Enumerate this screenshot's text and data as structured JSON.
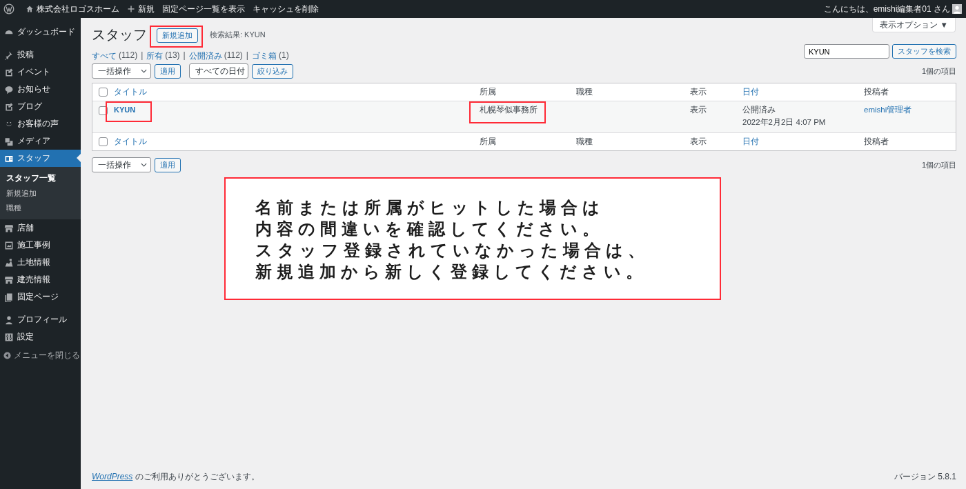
{
  "admin_bar": {
    "site_name": "株式会社ロゴスホーム",
    "new_label": "新規",
    "links": [
      "固定ページ一覧を表示",
      "キャッシュを削除"
    ],
    "greeting": "こんにちは、emishi編集者01 さん"
  },
  "sidebar": {
    "groups": [
      [
        {
          "label": "ダッシュボード",
          "kind": "gauge",
          "selected": false
        }
      ],
      [
        {
          "label": "投稿",
          "kind": "pin",
          "selected": false
        },
        {
          "label": "イベント",
          "kind": "note",
          "selected": false
        },
        {
          "label": "お知らせ",
          "kind": "bubble",
          "selected": false
        },
        {
          "label": "ブログ",
          "kind": "note",
          "selected": false
        },
        {
          "label": "お客様の声",
          "kind": "smile",
          "selected": false
        },
        {
          "label": "メディア",
          "kind": "media",
          "selected": false
        },
        {
          "label": "スタッフ",
          "kind": "card",
          "selected": true,
          "children": [
            {
              "label": "スタッフ一覧",
              "selected": true
            },
            {
              "label": "新規追加",
              "selected": false
            },
            {
              "label": "職種",
              "selected": false
            }
          ]
        },
        {
          "label": "店舗",
          "kind": "store",
          "selected": false
        },
        {
          "label": "施工事例",
          "kind": "gallery",
          "selected": false
        },
        {
          "label": "土地情報",
          "kind": "land",
          "selected": false
        },
        {
          "label": "建売情報",
          "kind": "store",
          "selected": false
        },
        {
          "label": "固定ページ",
          "kind": "pages",
          "selected": false
        }
      ],
      [
        {
          "label": "プロフィール",
          "kind": "person",
          "selected": false
        },
        {
          "label": "設定",
          "kind": "sliders",
          "selected": false
        }
      ]
    ],
    "collapse_label": "メニューを閉じる"
  },
  "screen_options": "表示オプション ▼",
  "page": {
    "title": "スタッフ",
    "add_new": {
      "label": "新規追加",
      "highlighted": true
    },
    "search_result": "検索結果: KYUN"
  },
  "views": [
    {
      "label": "すべて",
      "count": "(112)"
    },
    {
      "separator": "|",
      "label": "所有",
      "count": "(13)"
    },
    {
      "separator": "|",
      "label": "公開済み",
      "count": "(112)"
    },
    {
      "separator": "|",
      "label": "ゴミ箱",
      "count": "(1)"
    }
  ],
  "search": {
    "value": "KYUN",
    "button": "スタッフを検索"
  },
  "top_nav": {
    "bulk": "一括操作",
    "apply": "適用",
    "date": "すべての日付",
    "filter": "絞り込み",
    "count": "1個の項目"
  },
  "table": {
    "columns": [
      {
        "label": "タイトル",
        "sortable": true
      },
      {
        "label": "所属",
        "sortable": false
      },
      {
        "label": "職種",
        "sortable": false
      },
      {
        "label": "表示",
        "sortable": false
      },
      {
        "label": "日付",
        "sortable": true
      },
      {
        "label": "投稿者",
        "sortable": false
      }
    ],
    "rows": [
      {
        "checked": false,
        "title": "KYUN",
        "title_highlighted": true,
        "affiliation": "札幌琴似事務所",
        "affiliation_highlighted": true,
        "display": "表示",
        "status": "公開済み",
        "date": "2022年2月2日 4:07 PM",
        "author": "emishi管理者"
      }
    ],
    "footer_columns": [
      {
        "label": "タイトル",
        "sortable": true
      },
      {
        "label": "所属",
        "sortable": false
      },
      {
        "label": "職種",
        "sortable": false
      },
      {
        "label": "表示",
        "sortable": false
      },
      {
        "label": "日付",
        "sortable": true
      },
      {
        "label": "投稿者",
        "sortable": false
      }
    ],
    "header_checked": false,
    "footer_checked": false
  },
  "bottom_nav": {
    "bulk": "一括操作",
    "apply": "適用",
    "count": "1個の項目"
  },
  "note": {
    "lines": [
      "名前または所属がヒットした場合は",
      "内容の間違いを確認してください。",
      "スタッフ登録されていなかった場合は、",
      "新規追加から新しく登録してください。"
    ]
  },
  "footer": {
    "link": "WordPress",
    "thanks": "のご利用ありがとうございます。",
    "version": "バージョン 5.8.1"
  }
}
